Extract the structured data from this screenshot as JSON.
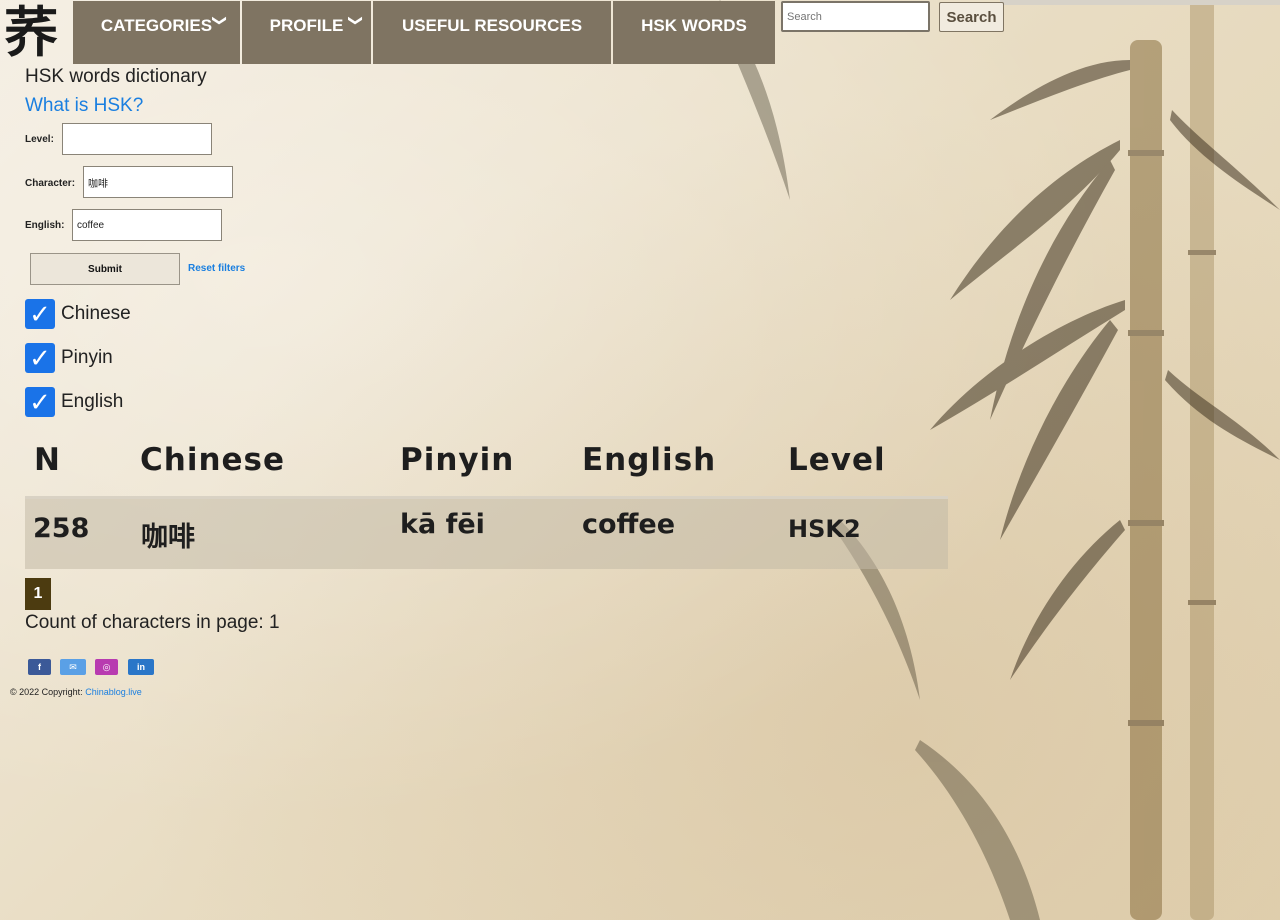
{
  "nav": {
    "logo_char": "荞",
    "items": [
      {
        "label": "CATEGORIES",
        "has_dropdown": true,
        "chevron": "❯"
      },
      {
        "label": "PROFILE",
        "has_dropdown": true,
        "chevron": "❯"
      },
      {
        "label": "USEFUL RESOURCES"
      },
      {
        "label": "HSK WORDS"
      }
    ],
    "search_placeholder": "Search",
    "search_button": "Search"
  },
  "page": {
    "title": "HSK words dictionary",
    "what_link": "What is HSK?"
  },
  "filters": {
    "level_label": "Level:",
    "level_value": "",
    "character_label": "Character:",
    "character_value": "咖啡",
    "english_label": "English:",
    "english_value": "coffee",
    "submit_label": "Submit",
    "reset_label": "Reset filters"
  },
  "columns_toggle": [
    {
      "label": "Chinese",
      "checked": true
    },
    {
      "label": "Pinyin",
      "checked": true
    },
    {
      "label": "English",
      "checked": true
    }
  ],
  "table": {
    "headers": [
      "N",
      "Chinese",
      "Pinyin",
      "English",
      "Level"
    ],
    "rows": [
      [
        "258",
        "咖啡",
        "kā fēi",
        "coffee",
        "HSK2"
      ]
    ]
  },
  "pagination": {
    "current": "1"
  },
  "count_text": "Count of characters in page: 1",
  "social": [
    {
      "icon": "facebook-icon",
      "glyph": "f",
      "color": "#3b5998"
    },
    {
      "icon": "wechat-icon",
      "glyph": "✉",
      "color": "#5aa0e6"
    },
    {
      "icon": "instagram-icon",
      "glyph": "◎",
      "color": "#b83bb0"
    },
    {
      "icon": "linkedin-icon",
      "glyph": "in",
      "color": "#2a76c8"
    }
  ],
  "footer": {
    "copyright": "© 2022 Copyright:",
    "link_text": "Chinablog.live"
  },
  "colors": {
    "nav_bg": "#7f7462",
    "link": "#1a7fe0",
    "checkbox": "#1a73e8",
    "pager": "#4c3b10"
  }
}
